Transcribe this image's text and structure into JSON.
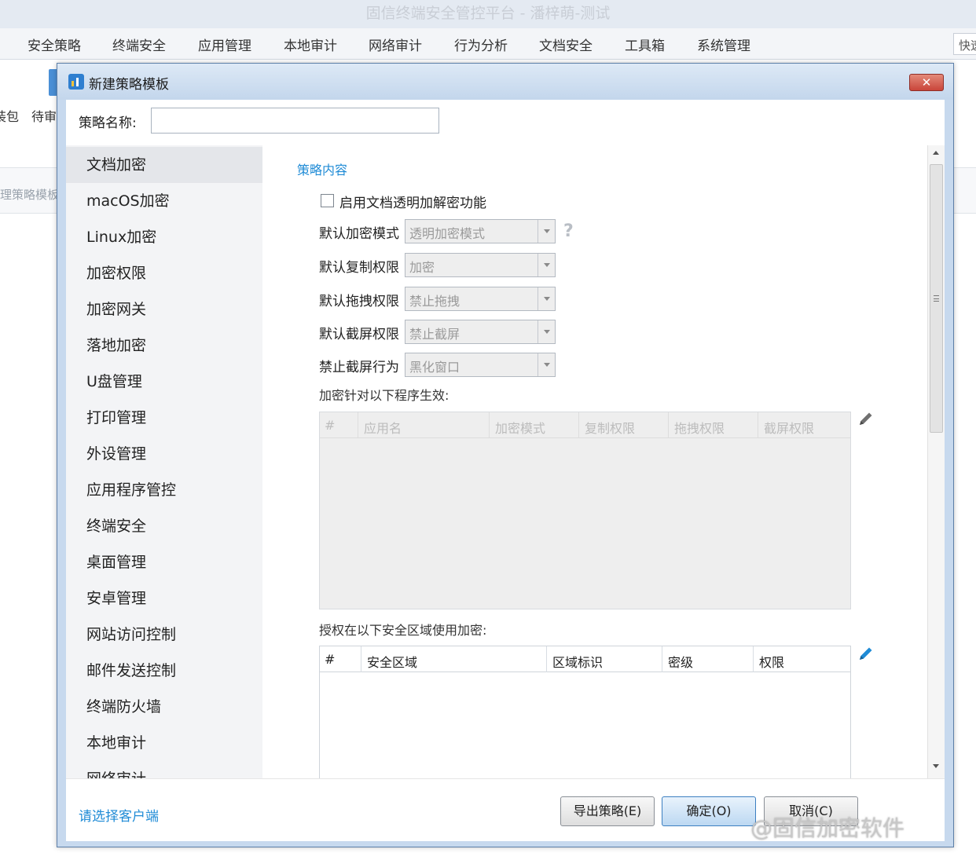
{
  "app": {
    "title": "固信终端安全管控平台 - 潘梓萌-测试",
    "menu": [
      "安全策略",
      "终端安全",
      "应用管理",
      "本地审计",
      "网络审计",
      "行为分析",
      "文档安全",
      "工具箱",
      "系统管理"
    ],
    "quick_search": "快速",
    "toolbar_labels": [
      "装包",
      "待审"
    ],
    "subbar_text": "理策略模板"
  },
  "dialog": {
    "title": "新建策略模板",
    "close_symbol": "✕",
    "name_label": "策略名称:",
    "name_value": "",
    "nav": [
      "文档加密",
      "macOS加密",
      "Linux加密",
      "加密权限",
      "加密网关",
      "落地加密",
      "U盘管理",
      "打印管理",
      "外设管理",
      "应用程序管控",
      "终端安全",
      "桌面管理",
      "安卓管理",
      "网站访问控制",
      "邮件发送控制",
      "终端防火墙",
      "本地审计",
      "网络审计"
    ],
    "content": {
      "section_title": "策略内容",
      "enable_label": "启用文档透明加解密功能",
      "enable_checked": false,
      "fields": [
        {
          "label": "默认加密模式",
          "value": "透明加密模式"
        },
        {
          "label": "默认复制权限",
          "value": "加密"
        },
        {
          "label": "默认拖拽权限",
          "value": "禁止拖拽"
        },
        {
          "label": "默认截屏权限",
          "value": "禁止截屏"
        },
        {
          "label": "禁止截屏行为",
          "value": "黑化窗口"
        }
      ],
      "help_symbol": "?",
      "programs_label": "加密针对以下程序生效:",
      "programs_columns": [
        "#",
        "应用名",
        "加密模式",
        "复制权限",
        "拖拽权限",
        "截屏权限"
      ],
      "zones_label": "授权在以下安全区域使用加密:",
      "zones_columns": [
        "#",
        "安全区域",
        "区域标识",
        "密级",
        "权限"
      ]
    },
    "footer": {
      "client_link": "请选择客户端",
      "export_button": "导出策略(E)",
      "ok_button": "确定(O)",
      "cancel_button": "取消(C)"
    }
  },
  "watermark": "@固信加密软件",
  "colors": {
    "link": "#1f8bd6",
    "dialog_frame": "#c7d9ee"
  }
}
